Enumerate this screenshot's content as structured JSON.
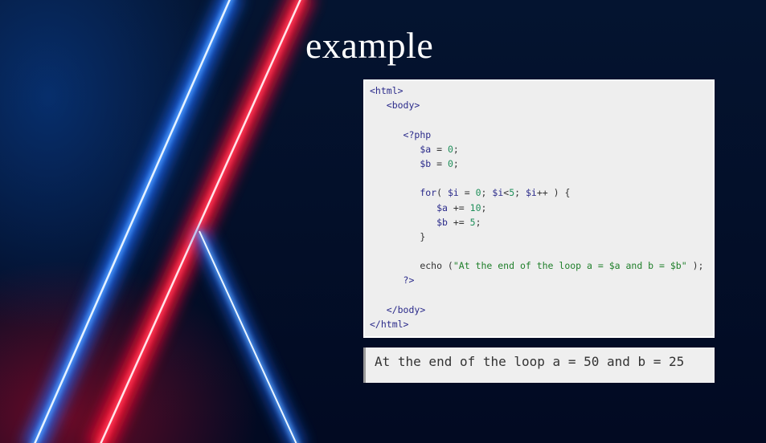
{
  "slide": {
    "title": "example"
  },
  "code_panel": {
    "lines": [
      {
        "indent": 0,
        "tokens": [
          {
            "t": "tag",
            "v": "<html>"
          }
        ]
      },
      {
        "indent": 1,
        "tokens": [
          {
            "t": "tag",
            "v": "<body>"
          }
        ]
      },
      {
        "indent": 0,
        "tokens": []
      },
      {
        "indent": 2,
        "tokens": [
          {
            "t": "tag",
            "v": "<?php"
          }
        ]
      },
      {
        "indent": 3,
        "tokens": [
          {
            "t": "var",
            "v": "$a"
          },
          {
            "t": "pl",
            "v": " = "
          },
          {
            "t": "num",
            "v": "0"
          },
          {
            "t": "pl",
            "v": ";"
          }
        ]
      },
      {
        "indent": 3,
        "tokens": [
          {
            "t": "var",
            "v": "$b"
          },
          {
            "t": "pl",
            "v": " = "
          },
          {
            "t": "num",
            "v": "0"
          },
          {
            "t": "pl",
            "v": ";"
          }
        ]
      },
      {
        "indent": 0,
        "tokens": []
      },
      {
        "indent": 3,
        "tokens": [
          {
            "t": "kw",
            "v": "for"
          },
          {
            "t": "pl",
            "v": "( "
          },
          {
            "t": "var",
            "v": "$i"
          },
          {
            "t": "pl",
            "v": " = "
          },
          {
            "t": "num",
            "v": "0"
          },
          {
            "t": "pl",
            "v": "; "
          },
          {
            "t": "var",
            "v": "$i"
          },
          {
            "t": "pl",
            "v": "<"
          },
          {
            "t": "num",
            "v": "5"
          },
          {
            "t": "pl",
            "v": "; "
          },
          {
            "t": "var",
            "v": "$i"
          },
          {
            "t": "pl",
            "v": "++ ) {"
          }
        ]
      },
      {
        "indent": 4,
        "tokens": [
          {
            "t": "var",
            "v": "$a"
          },
          {
            "t": "pl",
            "v": " += "
          },
          {
            "t": "num",
            "v": "10"
          },
          {
            "t": "pl",
            "v": ";"
          }
        ]
      },
      {
        "indent": 4,
        "tokens": [
          {
            "t": "var",
            "v": "$b"
          },
          {
            "t": "pl",
            "v": " += "
          },
          {
            "t": "num",
            "v": "5"
          },
          {
            "t": "pl",
            "v": ";"
          }
        ]
      },
      {
        "indent": 3,
        "tokens": [
          {
            "t": "pl",
            "v": "}"
          }
        ]
      },
      {
        "indent": 0,
        "tokens": []
      },
      {
        "indent": 3,
        "tokens": [
          {
            "t": "pl",
            "v": "echo ("
          },
          {
            "t": "str",
            "v": "\"At the end of the loop a = $a and b = $b\""
          },
          {
            "t": "pl",
            "v": " );"
          }
        ]
      },
      {
        "indent": 2,
        "tokens": [
          {
            "t": "tag",
            "v": "?>"
          }
        ]
      },
      {
        "indent": 0,
        "tokens": []
      },
      {
        "indent": 1,
        "tokens": [
          {
            "t": "tag",
            "v": "</body>"
          }
        ]
      },
      {
        "indent": 0,
        "tokens": [
          {
            "t": "tag",
            "v": "</html>"
          }
        ]
      }
    ]
  },
  "output_panel": {
    "text": "At the end of the loop a = 50 and b = 25"
  },
  "colors": {
    "background": "#020a22",
    "neon_blue": "#3b8cff",
    "neon_red": "#ff2a4a",
    "code_bg": "#eeeeee",
    "code_tag": "#2a2a8a",
    "code_number": "#1f8f5a",
    "code_string": "#1f7f2a"
  }
}
